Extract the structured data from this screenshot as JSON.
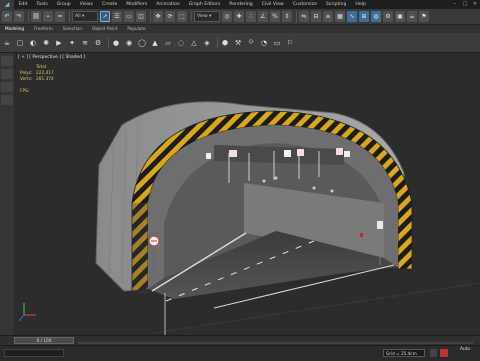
{
  "menu": {
    "app_icon": "3ds-max-logo-icon",
    "items": [
      "Edit",
      "Tools",
      "Group",
      "Views",
      "Create",
      "Modifiers",
      "Animation",
      "Graph Editors",
      "Rendering",
      "Civil View",
      "Customize",
      "Scripting",
      "Help"
    ]
  },
  "ribbon": {
    "tabs": [
      "Modeling",
      "Freeform",
      "Selection",
      "Object Paint",
      "Populate"
    ]
  },
  "viewport": {
    "label": "[ + ] [ Perspective ] [ Shaded ]",
    "stats": {
      "header": "Total",
      "polys_label": "Polys:",
      "polys_value": "222,417",
      "verts_label": "Verts:",
      "verts_value": "281,374"
    },
    "fps_label": "FPS:"
  },
  "timeline": {
    "frame": "0 / 100"
  },
  "status": {
    "coord": "Grid = 25.4cm",
    "autokey": "Auto"
  },
  "colors": {
    "accent": "#3c6e9c",
    "stripe_yellow": "#d9a71c",
    "stats_text": "#d8c36c"
  }
}
